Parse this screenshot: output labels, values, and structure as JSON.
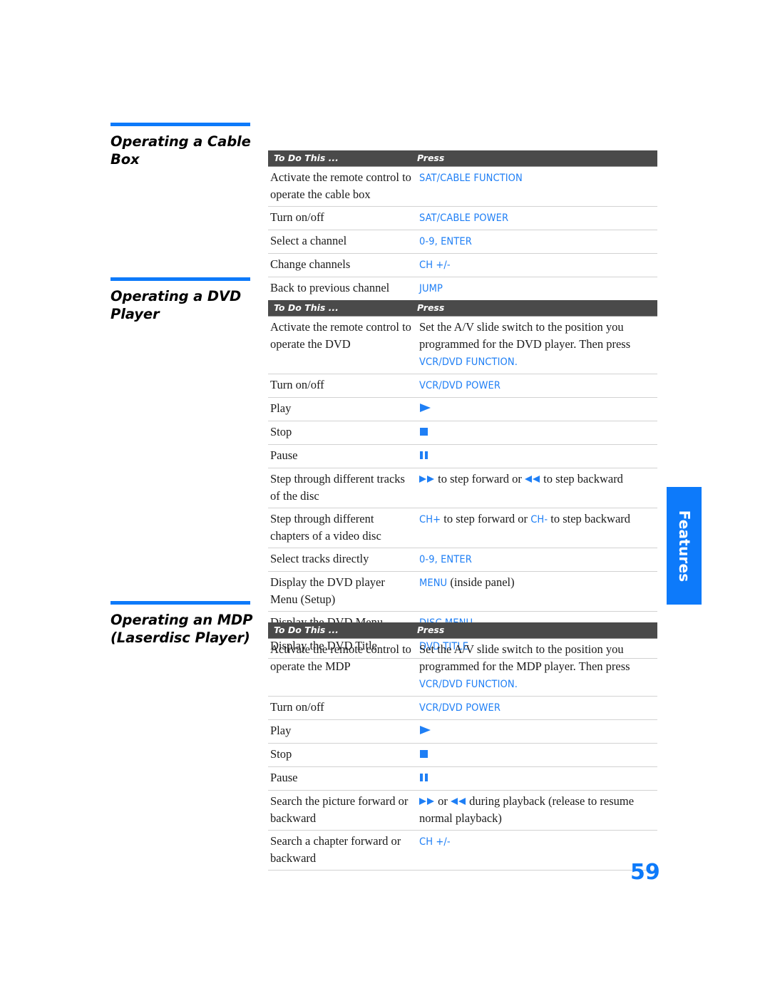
{
  "page": {
    "number": "59",
    "side_tab_label": "Features",
    "accent_color": "#0d7afa",
    "key_color": "#1f7ff5",
    "header_bar_color": "#4a4a4a"
  },
  "columns": {
    "to_do_this": "To Do This ...",
    "press": "Press"
  },
  "sections": [
    {
      "heading": "Operating a Cable Box",
      "rows": [
        {
          "todo": "Activate the remote control to operate the cable box",
          "press_parts": [
            {
              "type": "key",
              "text": "SAT/CABLE FUNCTION"
            }
          ]
        },
        {
          "todo": "Turn on/off",
          "press_parts": [
            {
              "type": "key",
              "text": "SAT/CABLE POWER"
            }
          ]
        },
        {
          "todo": "Select a channel",
          "press_parts": [
            {
              "type": "key",
              "text": "0-9, ENTER"
            }
          ]
        },
        {
          "todo": "Change channels",
          "press_parts": [
            {
              "type": "key",
              "text": "CH +/-"
            }
          ]
        },
        {
          "todo": "Back to previous channel",
          "press_parts": [
            {
              "type": "key",
              "text": "JUMP"
            }
          ]
        }
      ]
    },
    {
      "heading": "Operating a DVD Player",
      "rows": [
        {
          "todo": "Activate the remote control to operate the DVD",
          "press_parts": [
            {
              "type": "text",
              "text": "Set the A/V slide switch to the position you programmed for the DVD player. Then press "
            },
            {
              "type": "key",
              "text": "VCR/DVD FUNCTION."
            }
          ]
        },
        {
          "todo": "Turn on/off",
          "press_parts": [
            {
              "type": "key",
              "text": "VCR/DVD POWER"
            }
          ]
        },
        {
          "todo": "Play",
          "press_parts": [
            {
              "type": "icon",
              "icon": "play-icon"
            }
          ]
        },
        {
          "todo": "Stop",
          "press_parts": [
            {
              "type": "icon",
              "icon": "stop-icon"
            }
          ]
        },
        {
          "todo": "Pause",
          "press_parts": [
            {
              "type": "icon",
              "icon": "pause-icon"
            }
          ]
        },
        {
          "todo": "Step through different tracks of the disc",
          "press_parts": [
            {
              "type": "icon",
              "icon": "fast-forward-icon"
            },
            {
              "type": "text",
              "text": " to step forward or "
            },
            {
              "type": "icon",
              "icon": "rewind-icon"
            },
            {
              "type": "text",
              "text": " to step backward"
            }
          ]
        },
        {
          "todo": "Step through different chapters of a video disc",
          "press_parts": [
            {
              "type": "key",
              "text": "CH+"
            },
            {
              "type": "text",
              "text": " to step forward or "
            },
            {
              "type": "key",
              "text": "CH-"
            },
            {
              "type": "text",
              "text": " to step backward"
            }
          ]
        },
        {
          "todo": "Select tracks directly",
          "press_parts": [
            {
              "type": "key",
              "text": "0-9, ENTER"
            }
          ]
        },
        {
          "todo": "Display the DVD player Menu (Setup)",
          "press_parts": [
            {
              "type": "key",
              "text": "MENU"
            },
            {
              "type": "text",
              "text": " (inside panel)"
            }
          ]
        },
        {
          "todo": "Display the DVD Menu",
          "press_parts": [
            {
              "type": "key",
              "text": "DISC MENU"
            }
          ]
        },
        {
          "todo": "Display the DVD Title",
          "press_parts": [
            {
              "type": "key",
              "text": "DVD TITLE"
            }
          ]
        }
      ]
    },
    {
      "heading": "Operating an MDP (Laserdisc Player)",
      "rows": [
        {
          "todo": "Activate the remote control to operate the MDP",
          "press_parts": [
            {
              "type": "text",
              "text": "Set the A/V slide switch to the position you programmed for the MDP player. Then press "
            },
            {
              "type": "key",
              "text": "VCR/DVD FUNCTION."
            }
          ]
        },
        {
          "todo": "Turn on/off",
          "press_parts": [
            {
              "type": "key",
              "text": "VCR/DVD POWER"
            }
          ]
        },
        {
          "todo": "Play",
          "press_parts": [
            {
              "type": "icon",
              "icon": "play-icon"
            }
          ]
        },
        {
          "todo": "Stop",
          "press_parts": [
            {
              "type": "icon",
              "icon": "stop-icon"
            }
          ]
        },
        {
          "todo": "Pause",
          "press_parts": [
            {
              "type": "icon",
              "icon": "pause-icon"
            }
          ]
        },
        {
          "todo": "Search the picture forward or backward",
          "press_parts": [
            {
              "type": "icon",
              "icon": "fast-forward-icon"
            },
            {
              "type": "text",
              "text": " or "
            },
            {
              "type": "icon",
              "icon": "rewind-icon"
            },
            {
              "type": "text",
              "text": " during playback (release to resume normal playback)"
            }
          ]
        },
        {
          "todo": "Search a chapter forward or backward",
          "press_parts": [
            {
              "type": "key",
              "text": "CH +/-"
            }
          ]
        }
      ]
    }
  ],
  "layout": {
    "section_tops": [
      172,
      389,
      843
    ],
    "table_tops": [
      211,
      421,
      873
    ]
  }
}
